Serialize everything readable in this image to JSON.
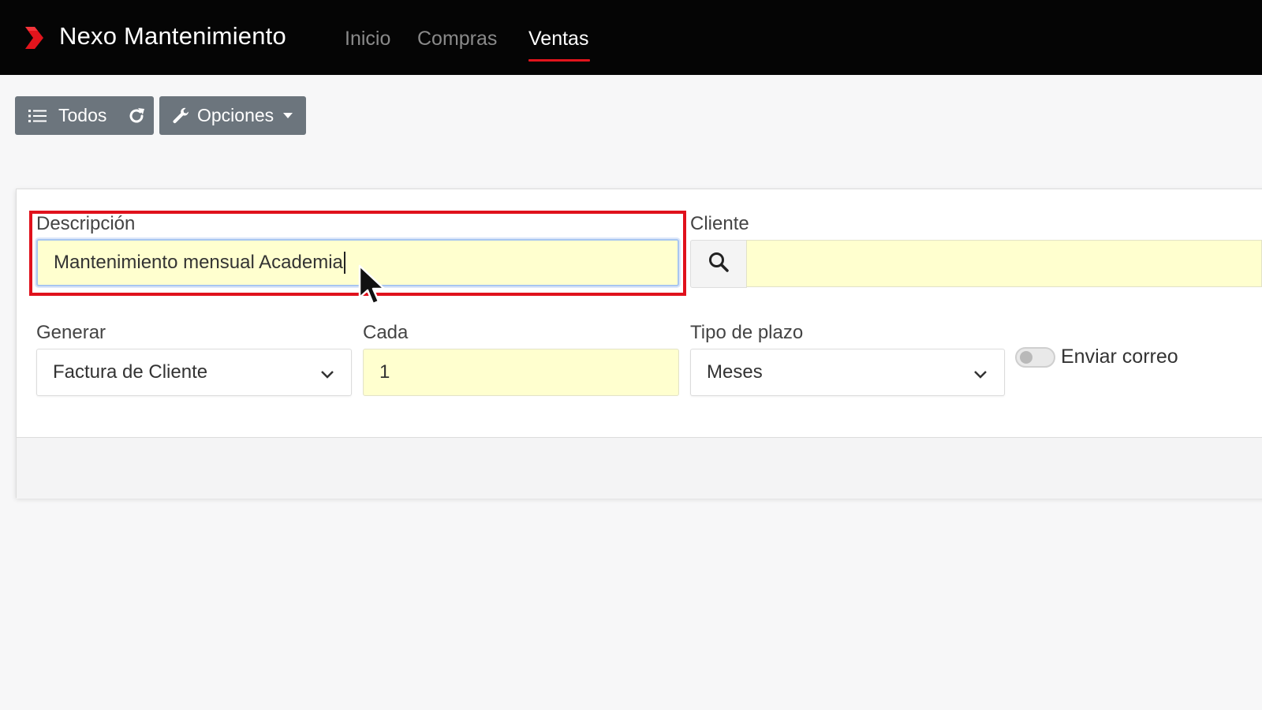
{
  "app": {
    "brand_name": "Nexo Mantenimiento",
    "brand_color": "#e1141c",
    "nav": [
      {
        "label": "Inicio",
        "active": false
      },
      {
        "label": "Compras",
        "active": false
      },
      {
        "label": "Ventas",
        "active": true
      }
    ]
  },
  "toolbar": {
    "todos_label": "Todos",
    "opciones_label": "Opciones",
    "icons": [
      "list-icon",
      "refresh-icon",
      "wrench-icon",
      "caret-down-icon"
    ]
  },
  "form": {
    "descripcion": {
      "label": "Descripción",
      "value": "Mantenimiento mensual Academia"
    },
    "cliente": {
      "label": "Cliente",
      "value": ""
    },
    "generar": {
      "label": "Generar",
      "selected": "Factura de Cliente"
    },
    "cada": {
      "label": "Cada",
      "value": "1"
    },
    "tipo_plazo": {
      "label": "Tipo de plazo",
      "selected": "Meses"
    },
    "enviar_correo": {
      "label": "Enviar correo",
      "checked": false
    }
  },
  "colors": {
    "navbar_bg": "#050505",
    "input_bg": "#ffffcf",
    "button_bg": "#6c757d",
    "highlight": "#e0111c"
  }
}
